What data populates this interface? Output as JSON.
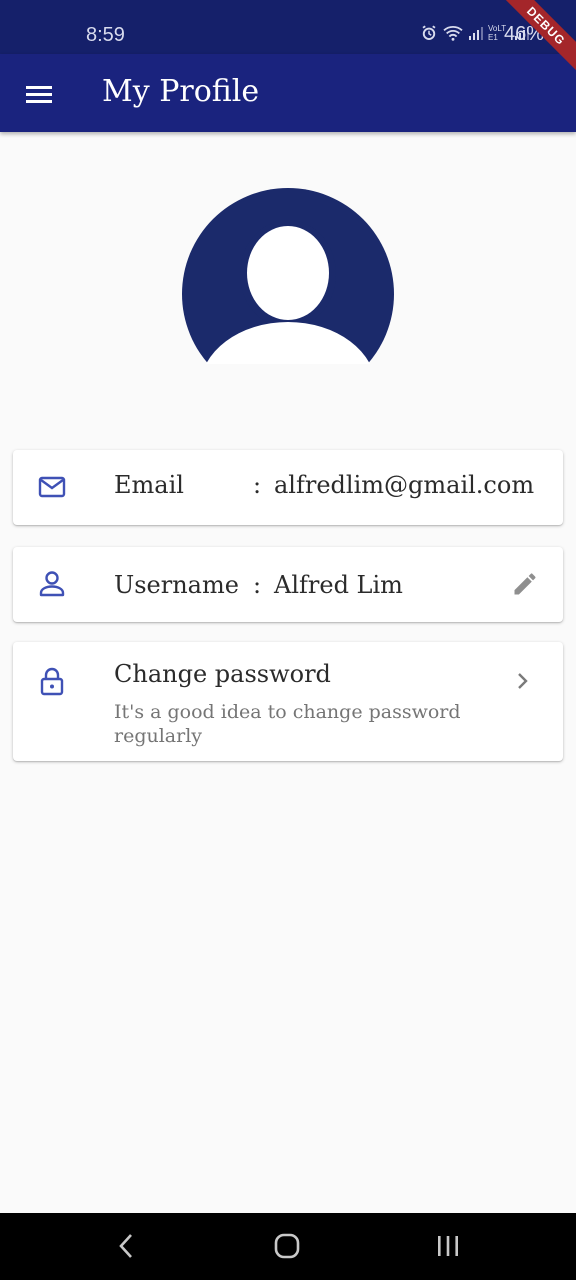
{
  "status_bar": {
    "time": "8:59",
    "network_label": "VoLTE1",
    "battery": "46%"
  },
  "debug_banner": "DEBUG",
  "app_bar": {
    "title": "My Profile",
    "menu_icon": "menu-icon"
  },
  "profile": {
    "avatar_icon": "account-circle-icon",
    "email": {
      "icon": "mail-icon",
      "label": "Email",
      "separator": ":",
      "value": "alfredlim@gmail.com"
    },
    "username": {
      "icon": "person-icon",
      "label": "Username",
      "separator": ":",
      "value": "Alfred Lim",
      "action_icon": "edit-icon"
    },
    "change_password": {
      "icon": "lock-icon",
      "title": "Change password",
      "subtitle": "It's a good idea to change password regularly",
      "action_icon": "chevron-right-icon"
    }
  },
  "colors": {
    "app_bar": "#1a237e",
    "status_bar": "#15206a",
    "icon_accent": "#3f51b5",
    "background": "#fafafa"
  }
}
